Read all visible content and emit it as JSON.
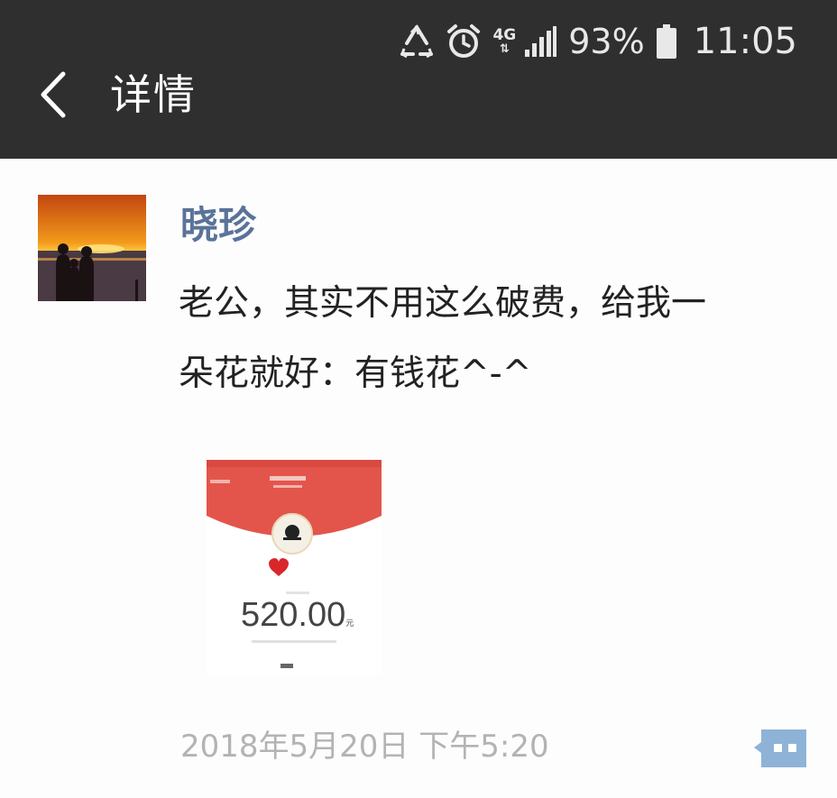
{
  "status_bar": {
    "network": "4G",
    "battery": "93%",
    "time": "11:05"
  },
  "header": {
    "title": "详情"
  },
  "post": {
    "author": "晓珍",
    "message_line1": "老公，其实不用这么破费，给我一",
    "message_line2": "朵花就好：有钱花^-^",
    "timestamp": "2018年5月20日 下午5:20",
    "image": {
      "amount": "520.00"
    }
  },
  "colors": {
    "topbar": "#2f2f2f",
    "name": "#5a7399",
    "comment_icon": "#8fb3d6",
    "red_packet": "#e3554b"
  }
}
